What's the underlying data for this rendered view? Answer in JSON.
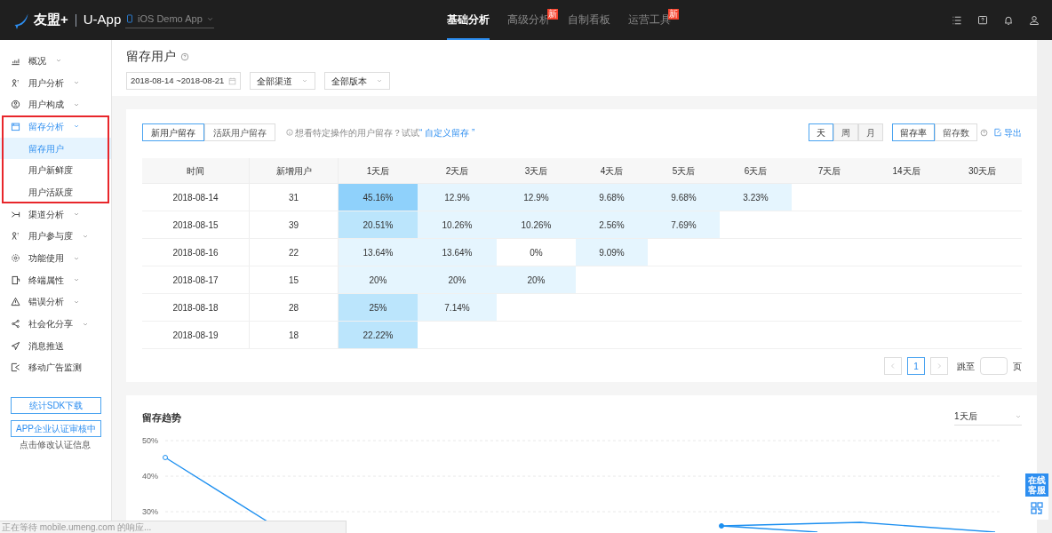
{
  "topbar": {
    "logo": "友盟+",
    "product": "U-App",
    "app_selector": "iOS Demo App",
    "tabs": [
      {
        "label": "基础分析",
        "selected": true
      },
      {
        "label": "高级分析",
        "selected": false,
        "badge": "新"
      },
      {
        "label": "自制看板",
        "selected": false
      },
      {
        "label": "运营工具",
        "selected": false,
        "badge": "新"
      }
    ]
  },
  "sidebar": {
    "items": [
      {
        "label": "概况",
        "expandable": true,
        "expanded": false
      },
      {
        "label": "用户分析",
        "expandable": true,
        "expanded": false
      },
      {
        "label": "用户构成",
        "expandable": true,
        "expanded": false
      },
      {
        "label": "留存分析",
        "expandable": true,
        "expanded": true,
        "highlighted": true,
        "children": [
          {
            "label": "留存用户",
            "selected": true
          },
          {
            "label": "用户新鲜度",
            "selected": false
          },
          {
            "label": "用户活跃度",
            "selected": false
          }
        ]
      },
      {
        "label": "渠道分析",
        "expandable": true,
        "expanded": false
      },
      {
        "label": "用户参与度",
        "expandable": true,
        "expanded": false
      },
      {
        "label": "功能使用",
        "expandable": true,
        "expanded": false
      },
      {
        "label": "终端属性",
        "expandable": true,
        "expanded": false
      },
      {
        "label": "错误分析",
        "expandable": true,
        "expanded": false
      },
      {
        "label": "社会化分享",
        "expandable": true,
        "expanded": false
      },
      {
        "label": "消息推送",
        "expandable": false
      },
      {
        "label": "移动广告监测",
        "expandable": false
      }
    ],
    "buttons": [
      "统计SDK下载",
      "APP企业认证审核中"
    ],
    "auth_note": "点击修改认证信息"
  },
  "page": {
    "title": "留存用户",
    "date_range": "2018-08-14 ~2018-08-21",
    "dropdowns": [
      "全部渠道",
      "全部版本"
    ]
  },
  "retention": {
    "user_tabs": [
      {
        "label": "新用户留存",
        "selected": true
      },
      {
        "label": "活跃用户留存",
        "selected": false
      }
    ],
    "hint": "想看特定操作的用户留存？试试",
    "hint_link": "“ 自定义留存 ”",
    "period_tabs": [
      {
        "label": "天",
        "selected": true
      },
      {
        "label": "周",
        "selected": false
      },
      {
        "label": "月",
        "selected": false
      }
    ],
    "metric_tabs": [
      {
        "label": "留存率",
        "selected": true
      },
      {
        "label": "留存数",
        "selected": false
      }
    ],
    "export": "导出",
    "table": {
      "columns": [
        "时间",
        "新增用户",
        "1天后",
        "2天后",
        "3天后",
        "4天后",
        "5天后",
        "6天后",
        "7天后",
        "14天后",
        "30天后"
      ],
      "rows": [
        {
          "cells": [
            {
              "value": "2018-08-14"
            },
            {
              "value": "31"
            },
            {
              "value": "45.16%",
              "color": "#8fd1fb"
            },
            {
              "value": "12.9%",
              "color": "#e5f5fe"
            },
            {
              "value": "12.9%",
              "color": "#e5f5fe"
            },
            {
              "value": "9.68%",
              "color": "#e5f5fe"
            },
            {
              "value": "9.68%",
              "color": "#e5f5fe"
            },
            {
              "value": "3.23%",
              "color": "#e5f5fe"
            }
          ]
        },
        {
          "cells": [
            {
              "value": "2018-08-15"
            },
            {
              "value": "39"
            },
            {
              "value": "20.51%",
              "color": "#bbe5fc"
            },
            {
              "value": "10.26%",
              "color": "#e5f5fe"
            },
            {
              "value": "10.26%",
              "color": "#e5f5fe"
            },
            {
              "value": "2.56%",
              "color": "#e5f5fe"
            },
            {
              "value": "7.69%",
              "color": "#e5f5fe"
            }
          ]
        },
        {
          "cells": [
            {
              "value": "2018-08-16"
            },
            {
              "value": "22"
            },
            {
              "value": "13.64%",
              "color": "#e5f5fe"
            },
            {
              "value": "13.64%",
              "color": "#e5f5fe"
            },
            {
              "value": "0%",
              "color": "#ffffff"
            },
            {
              "value": "9.09%",
              "color": "#e5f5fe"
            }
          ]
        },
        {
          "cells": [
            {
              "value": "2018-08-17"
            },
            {
              "value": "15"
            },
            {
              "value": "20%",
              "color": "#e5f5fe"
            },
            {
              "value": "20%",
              "color": "#e5f5fe"
            },
            {
              "value": "20%",
              "color": "#e5f5fe"
            }
          ]
        },
        {
          "cells": [
            {
              "value": "2018-08-18"
            },
            {
              "value": "28"
            },
            {
              "value": "25%",
              "color": "#bbe5fc"
            },
            {
              "value": "7.14%",
              "color": "#e5f5fe"
            }
          ]
        },
        {
          "cells": [
            {
              "value": "2018-08-19"
            },
            {
              "value": "18"
            },
            {
              "value": "22.22%",
              "color": "#bbe5fc"
            }
          ]
        }
      ]
    },
    "pagination": {
      "pages": [
        {
          "label": "1",
          "selected": true
        }
      ],
      "jump_label": "跳至",
      "page_unit": "页"
    }
  },
  "trend": {
    "title": "留存趋势",
    "selector": "1天后",
    "y_axis_labels": [
      "50%",
      "40%",
      "30%"
    ]
  },
  "support_widget": "在线客服",
  "browser_status": "正在等待 mobile.umeng.com 的响应..."
}
